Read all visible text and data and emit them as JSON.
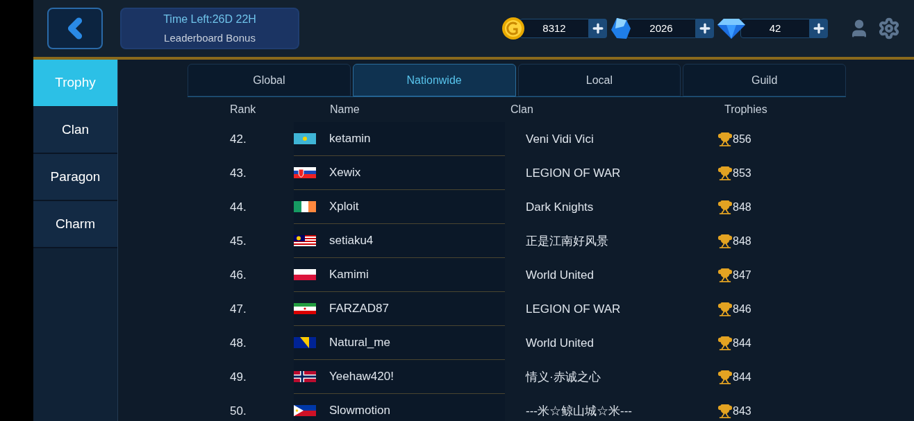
{
  "header": {
    "timer": "Time Left:26D 22H",
    "bonus_label": "Leaderboard Bonus"
  },
  "currencies": [
    {
      "kind": "coin",
      "amount": "8312"
    },
    {
      "kind": "crystal",
      "amount": "2026"
    },
    {
      "kind": "diamond",
      "amount": "42"
    }
  ],
  "sidebar": {
    "items": [
      {
        "label": "Trophy",
        "selected": true
      },
      {
        "label": "Clan",
        "selected": false
      },
      {
        "label": "Paragon",
        "selected": false
      },
      {
        "label": "Charm",
        "selected": false
      }
    ]
  },
  "tabs": [
    {
      "label": "Global",
      "selected": false
    },
    {
      "label": "Nationwide",
      "selected": true
    },
    {
      "label": "Local",
      "selected": false
    },
    {
      "label": "Guild",
      "selected": false
    }
  ],
  "table": {
    "columns": [
      "Rank",
      "Name",
      "Clan",
      "Trophies"
    ],
    "rows": [
      {
        "rank": "42.",
        "kind": "kz",
        "name": "ketamin",
        "clan": "Veni Vidi Vici",
        "trophies": "856"
      },
      {
        "rank": "43.",
        "kind": "sk",
        "name": "Xewix",
        "clan": "LEGION OF WAR",
        "trophies": "853"
      },
      {
        "rank": "44.",
        "kind": "ie",
        "name": "Xploit",
        "clan": "Dark Knights",
        "trophies": "848"
      },
      {
        "rank": "45.",
        "kind": "my",
        "name": "setiaku4",
        "clan": "正是江南好风景",
        "trophies": "848"
      },
      {
        "rank": "46.",
        "kind": "pl",
        "name": "Kamimi",
        "clan": "World United",
        "trophies": "847"
      },
      {
        "rank": "47.",
        "kind": "ir",
        "name": "FARZAD87",
        "clan": "LEGION OF WAR",
        "trophies": "846"
      },
      {
        "rank": "48.",
        "kind": "ba",
        "name": "Natural_me",
        "clan": "World United",
        "trophies": "844"
      },
      {
        "rank": "49.",
        "kind": "no",
        "name": "Yeehaw420!",
        "clan": "情义·赤诚之心",
        "trophies": "844"
      },
      {
        "rank": "50.",
        "kind": "ph",
        "name": "Slowmotion",
        "clan": "---米☆鲸山城☆米---",
        "trophies": "843"
      }
    ]
  }
}
